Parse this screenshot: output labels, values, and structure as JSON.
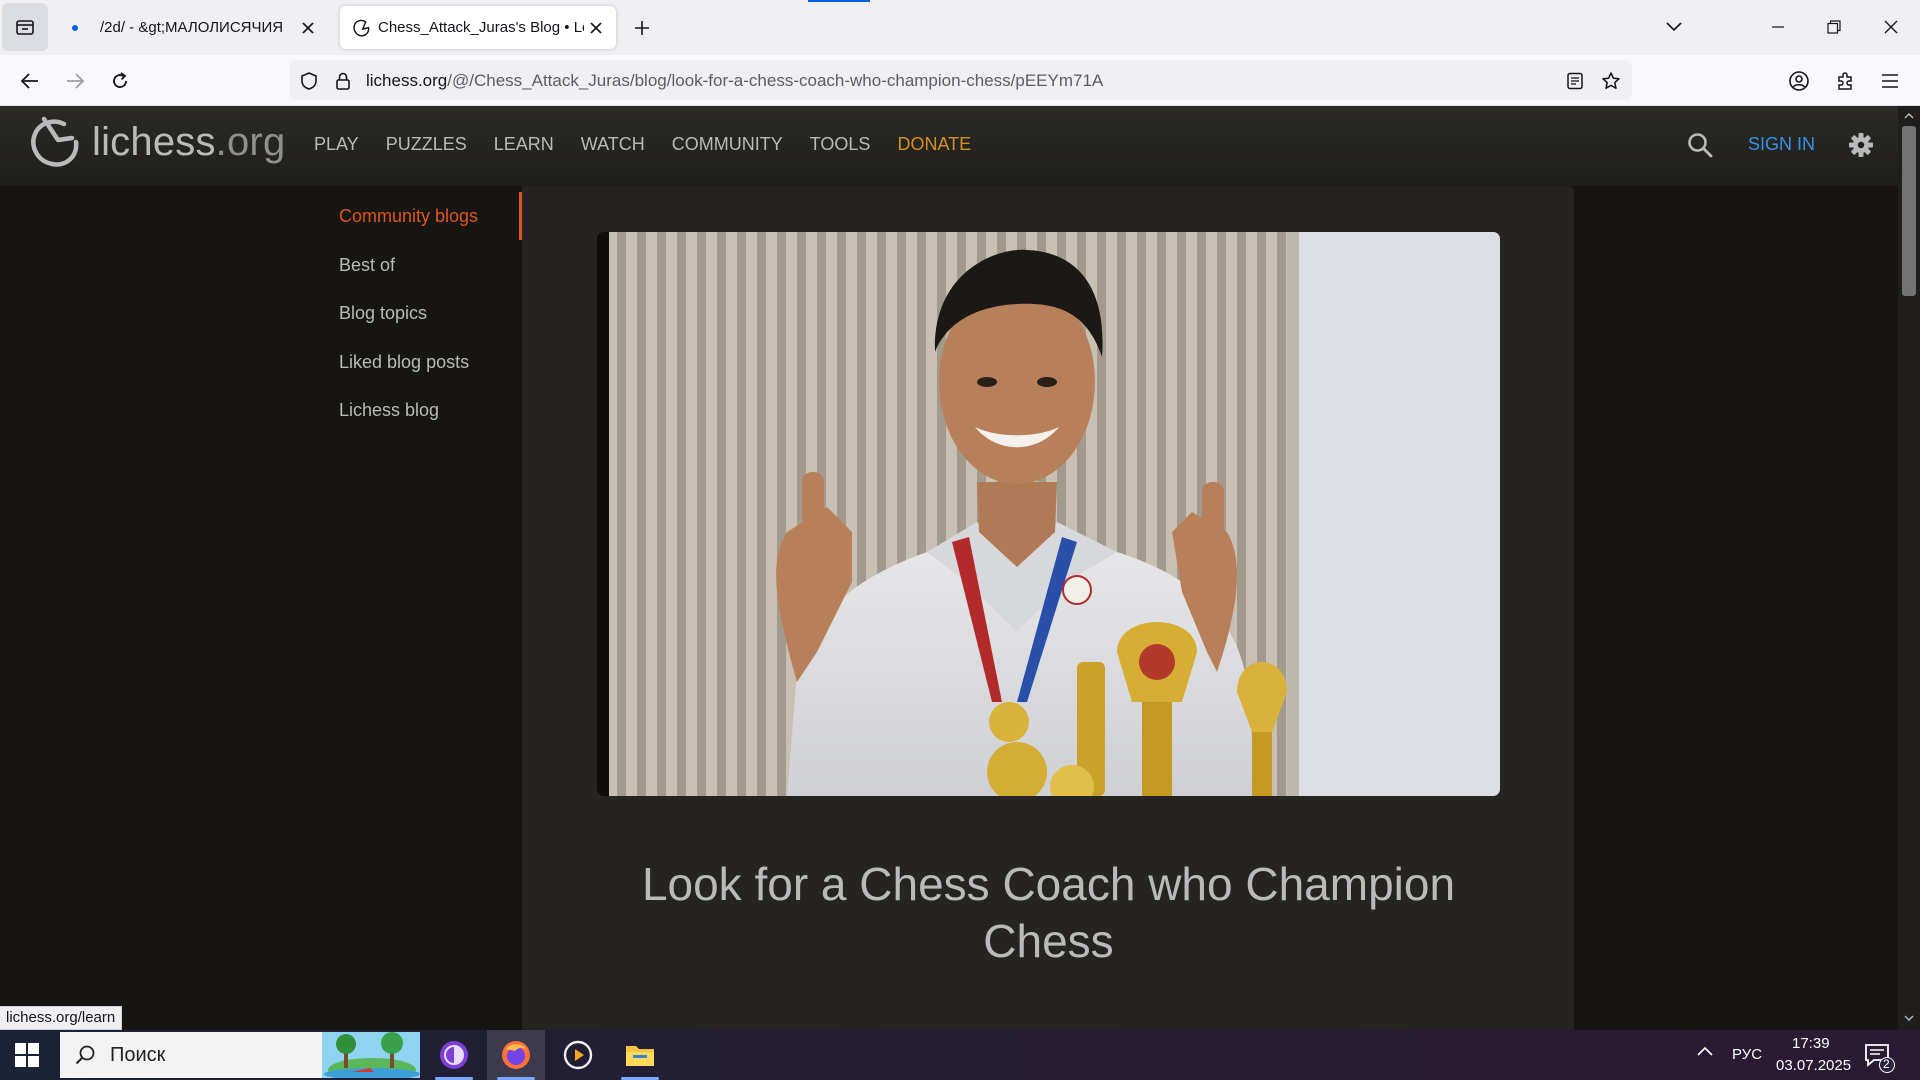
{
  "browser": {
    "tabs": [
      {
        "title": "/2d/ - &gt;МАЛОЛИСЯЧИЯ",
        "active": false
      },
      {
        "title": "Chess_Attack_Juras's Blog • Look for a Chess Coach who Champion Chess",
        "active": true
      }
    ],
    "url_host": "lichess.org",
    "url_path": "/@/Chess_Attack_Juras/blog/look-for-a-chess-coach-who-champion-chess/pEEYm71A",
    "status_url": "lichess.org/learn"
  },
  "site": {
    "logo_main": "lichess",
    "logo_suffix": ".org",
    "nav": [
      "PLAY",
      "PUZZLES",
      "LEARN",
      "WATCH",
      "COMMUNITY",
      "TOOLS"
    ],
    "donate": "DONATE",
    "sign_in": "SIGN IN",
    "accent_color": "#e05420",
    "link_color": "#3692e7",
    "donate_color": "#d59120"
  },
  "sidebar": {
    "items": [
      {
        "label": "Community blogs",
        "active": true
      },
      {
        "label": "Best of",
        "active": false
      },
      {
        "label": "Blog topics",
        "active": false
      },
      {
        "label": "Liked blog posts",
        "active": false
      },
      {
        "label": "Lichess blog",
        "active": false
      }
    ]
  },
  "post": {
    "title": "Look for a Chess Coach who Champion Chess"
  },
  "taskbar": {
    "search_placeholder": "Поиск",
    "language": "РУС",
    "time": "17:39",
    "date": "03.07.2025",
    "notifications": "2"
  }
}
